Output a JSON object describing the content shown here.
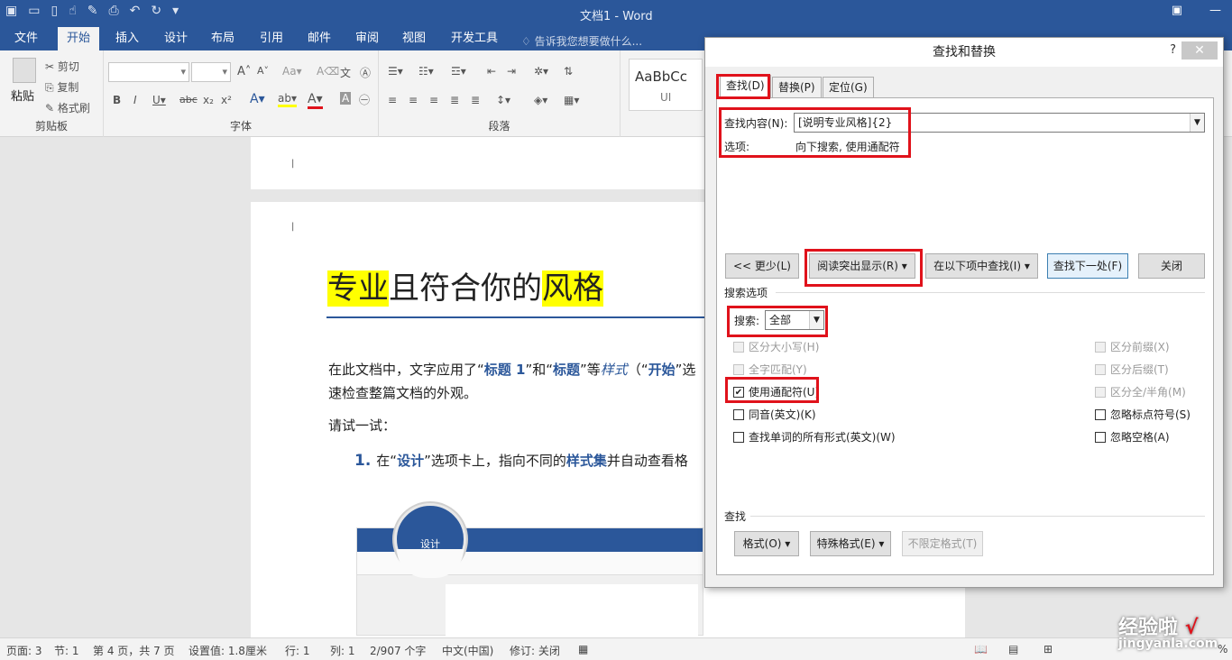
{
  "window": {
    "title": "文档1 - Word"
  },
  "tabs": [
    "文件",
    "开始",
    "插入",
    "设计",
    "布局",
    "引用",
    "邮件",
    "审阅",
    "视图",
    "开发工具"
  ],
  "tell_me": "告诉我您想要做什么...",
  "ribbon": {
    "clipboard": {
      "paste": "粘贴",
      "cut": "剪切",
      "copy": "复制",
      "format_painter": "格式刷",
      "group": "剪贴板"
    },
    "font_group": "字体",
    "paragraph_group": "段落",
    "style_preview": "AaBbCc",
    "style_name": "UI"
  },
  "document": {
    "title_part1": "专业",
    "title_part2": "且符合你的",
    "title_part3": "风格",
    "para1_a": "在此文档中，文字应用了“",
    "para1_b": "标题 1",
    "para1_c": "”和“",
    "para1_d": "标题",
    "para1_e": "”等",
    "para1_f": "样式",
    "para1_g": "（“",
    "para1_h": "开始",
    "para1_i": "”选",
    "para2": "速检查整篇文档的外观。",
    "para3": "请试一试：",
    "item_num": "1.",
    "item_a": "在“",
    "item_b": "设计",
    "item_c": "”选项卡上，指向不同的",
    "item_d": "样式集",
    "item_e": "并自动查看格",
    "magnifier_label": "设计"
  },
  "dialog": {
    "title": "查找和替换",
    "help": "?",
    "close": "✕",
    "tabs": [
      "查找(D)",
      "替换(P)",
      "定位(G)"
    ],
    "find_label": "查找内容(N):",
    "find_value": "[说明专业风格]{2}",
    "options_label": "选项:",
    "options_value": "向下搜索, 使用通配符",
    "buttons": {
      "less": "<< 更少(L)",
      "highlight": "阅读突出显示(R) ▾",
      "find_in": "在以下项中查找(I) ▾",
      "find_next": "查找下一处(F)",
      "close": "关闭"
    },
    "search_options_label": "搜索选项",
    "search_label": "搜索:",
    "search_value": "全部",
    "checkboxes_left": [
      {
        "label": "区分大小写(H)",
        "checked": false,
        "disabled": true
      },
      {
        "label": "全字匹配(Y)",
        "checked": false,
        "disabled": true
      },
      {
        "label": "使用通配符(U)",
        "checked": true,
        "disabled": false
      },
      {
        "label": "同音(英文)(K)",
        "checked": false,
        "disabled": false
      },
      {
        "label": "查找单词的所有形式(英文)(W)",
        "checked": false,
        "disabled": false
      }
    ],
    "checkboxes_right": [
      {
        "label": "区分前缀(X)",
        "checked": false,
        "disabled": true
      },
      {
        "label": "区分后缀(T)",
        "checked": false,
        "disabled": true
      },
      {
        "label": "区分全/半角(M)",
        "checked": false,
        "disabled": true
      },
      {
        "label": "忽略标点符号(S)",
        "checked": false,
        "disabled": false
      },
      {
        "label": "忽略空格(A)",
        "checked": false,
        "disabled": false
      }
    ],
    "find_section": "查找",
    "format_btn": "格式(O) ▾",
    "special_btn": "特殊格式(E) ▾",
    "noformat_btn": "不限定格式(T)"
  },
  "status": {
    "page": "页面: 3",
    "section": "节: 1",
    "pages": "第 4 页，共 7 页",
    "at": "设置值: 1.8厘米",
    "line": "行: 1",
    "col": "列: 1",
    "words": "2/907 个字",
    "lang": "中文(中国)",
    "track": "修订: 关闭",
    "zoom": "%"
  },
  "watermark": {
    "line1": "经验啦",
    "check": "√",
    "line2": "jingyanla.com"
  },
  "colors": {
    "accent": "#2b579a",
    "highlight": "#ffff00",
    "annotation": "#e0121b"
  }
}
